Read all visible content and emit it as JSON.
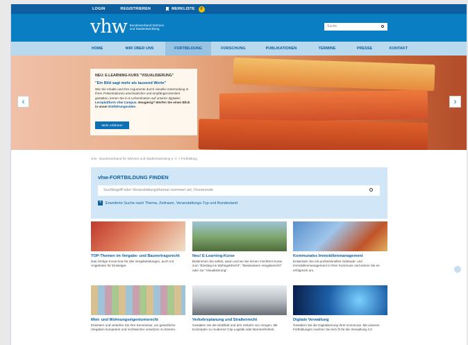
{
  "topbar": {
    "login": "LOGIN",
    "register": "REGISTRIEREN",
    "watchlist": "MERKLISTE",
    "watchlist_count": "0"
  },
  "header": {
    "logo_mark": "vhw",
    "logo_sub": "Bundesverband Wohnen und Stadtentwicklung",
    "search_placeholder": "Suche"
  },
  "nav": [
    "HOME",
    "WIR ÜBER UNS",
    "FORTBILDUNG",
    "FORSCHUNG",
    "PUBLIKATIONEN",
    "TERMINE",
    "PRESSE",
    "KONTAKT"
  ],
  "hero": {
    "kicker": "NEU: E-LEARNING-KURS \"VISUALISIERUNG\"",
    "quote": "\"Ein Bild sagt mehr als tausend Worte\"",
    "body_a": "Wie Sie Inhalte und Ihre Argumente durch visuelle Untermalung in Ihren Präsentationen anschaulicher und empfängerorientiert gestalten, lernen Sie in 8 Lehreinheiten auf unserer digitalen ",
    "body_link1": "Lernplattform vhw Campus",
    "body_b": ". Neugierig? Werfen Sie einen Blick in unser ",
    "body_link2": "Einführungsvideo",
    "body_c": ".",
    "cta": "Mehr erfahren!"
  },
  "breadcrumb": "vhw - Bundesverband für Wohnen und Stadtentwicklung e. V. > Fortbildung",
  "finder": {
    "heading": "vhw-FORTBILDUNG FINDEN",
    "placeholder": "Suchbegriff oder Veranstaltungsthema/-nummer/-art, Dozierende",
    "extended": "Erweiterte Suche nach Thema, Zeitraum, Veranstaltungs-Typ und Bundesland"
  },
  "cards": [
    {
      "title": "TOP-Themen im Vergabe- und Bauvertragsrecht",
      "text": "Das richtige Know-how für alle Vergabeleitungen, auch mit Angeboten für Einsteiger."
    },
    {
      "title": "Neu! E-Learning-Kurse",
      "text": "Bestimmen Sie selbst, wann und wo Sie lernen möchten! Kurse zum \"Einstieg ins Wohngeldrecht\", \"Basiswissen Vergaberecht\" oder zur \"Visualisierung\"."
    },
    {
      "title": "Kommunales Immobilienmanagement",
      "text": "Entwickeln Sie ein professionelles Gebäude- und Immobilienmanagement in Ihrer Kommune und setzen Sie es erfolgreich um."
    },
    {
      "title": "Miet- und Wohnungseigentumsrecht",
      "text": "Erweitern und vertiefen Sie Ihre Kenntnisse, um gesetzliche Vorgaben kompetent und rechtssicher umsetzen zu können."
    },
    {
      "title": "Verkehrsplanung und Straßenrecht",
      "text": "Gestalten Sie die Mobilität und den Verkehr von morgen. Mit Konzepten zu moderner City-Logistik oder Barrierefreiheit."
    },
    {
      "title": "Digitale Verwaltung",
      "text": "Gestalten Sie die Digitalisierung Ihrer Kommune. Mit unseren Fortbildungen machen Sie sich fit für die Verwaltung 4.0."
    }
  ]
}
